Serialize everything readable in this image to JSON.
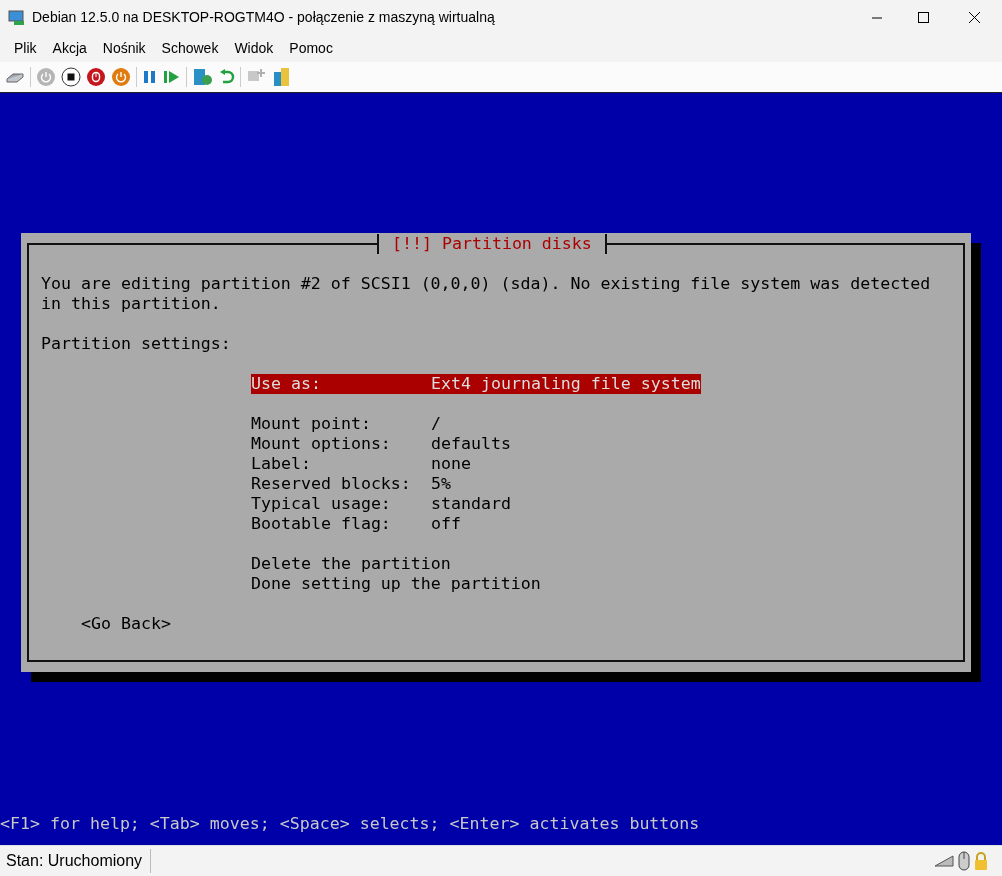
{
  "window": {
    "title": "Debian 12.5.0 na DESKTOP-ROGTM4O - połączenie z maszyną wirtualną"
  },
  "menu": [
    "Plik",
    "Akcja",
    "Nośnik",
    "Schowek",
    "Widok",
    "Pomoc"
  ],
  "dialog": {
    "title": "[!!] Partition disks",
    "message": "You are editing partition #2 of SCSI1 (0,0,0) (sda). No existing file system was detected in this partition.",
    "section_label": "Partition settings:",
    "settings": [
      {
        "label": "Use as:",
        "value": "Ext4 journaling file system",
        "selected": true
      },
      {
        "label": "Mount point:",
        "value": "/",
        "selected": false
      },
      {
        "label": "Mount options:",
        "value": "defaults",
        "selected": false
      },
      {
        "label": "Label:",
        "value": "none",
        "selected": false
      },
      {
        "label": "Reserved blocks:",
        "value": "5%",
        "selected": false
      },
      {
        "label": "Typical usage:",
        "value": "standard",
        "selected": false
      },
      {
        "label": "Bootable flag:",
        "value": "off",
        "selected": false
      }
    ],
    "actions": [
      {
        "label": "Delete the partition",
        "selected": false
      },
      {
        "label": "Done setting up the partition",
        "selected": false
      }
    ],
    "back_button": {
      "label": "<Go Back>",
      "selected": false
    }
  },
  "help_line": "<F1> for help; <Tab> moves; <Space> selects; <Enter> activates buttons",
  "status_bar": {
    "text": "Stan: Uruchomiony"
  }
}
